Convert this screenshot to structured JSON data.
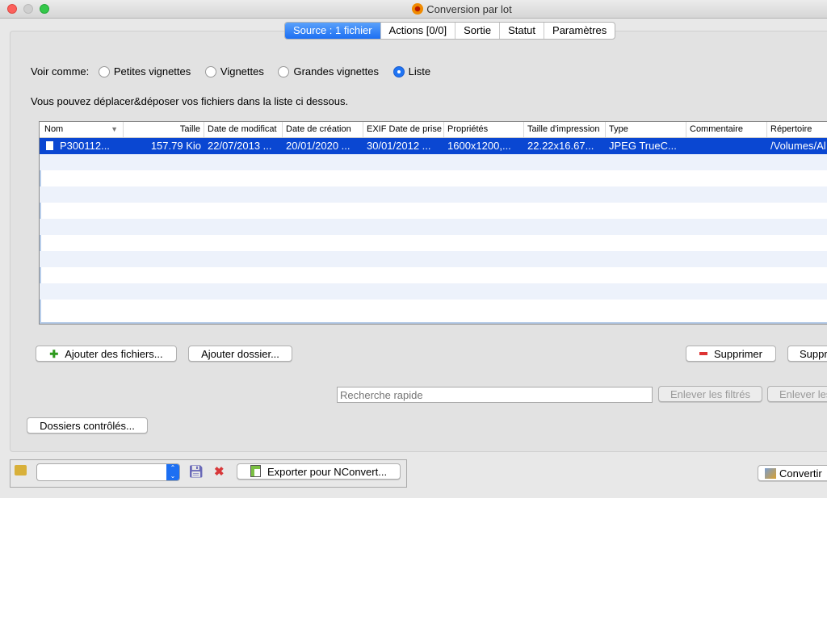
{
  "window": {
    "title": "Conversion par lot"
  },
  "tabs": [
    {
      "label": "Source : 1 fichier",
      "active": true
    },
    {
      "label": "Actions [0/0]"
    },
    {
      "label": "Sortie"
    },
    {
      "label": "Statut"
    },
    {
      "label": "Paramètres"
    }
  ],
  "view": {
    "label": "Voir comme:",
    "options": [
      {
        "label": "Petites vignettes",
        "checked": false
      },
      {
        "label": "Vignettes",
        "checked": false
      },
      {
        "label": "Grandes vignettes",
        "checked": false
      },
      {
        "label": "Liste",
        "checked": true
      }
    ]
  },
  "hint": "Vous pouvez déplacer&déposer vos fichiers dans la liste ci dessous.",
  "table": {
    "columns": [
      "Nom",
      "Taille",
      "Date de modificat",
      "Date de création",
      "EXIF Date de prise",
      "Propriétés",
      "Taille d'impression",
      "Type",
      "Commentaire",
      "Répertoire"
    ],
    "rows": [
      [
        "P300112...",
        "157.79 Kio",
        "22/07/2013 ...",
        "20/01/2020 ...",
        "30/01/2012 ...",
        "1600x1200,...",
        "22.22x16.67...",
        "JPEG TrueC...",
        "",
        "/Volumes/Al"
      ]
    ]
  },
  "buttons": {
    "add_files": "Ajouter des fichiers...",
    "add_folder": "Ajouter dossier...",
    "remove": "Supprimer",
    "remove_all": "Suppr",
    "remove_filtered": "Enlever les filtrés",
    "remove_all_filtered": "Enlever les",
    "watched": "Dossiers contrôlés...",
    "export": "Exporter pour NConvert...",
    "convert": "Convertir"
  },
  "search": {
    "placeholder": "Recherche rapide"
  },
  "preset": {
    "value": ""
  }
}
